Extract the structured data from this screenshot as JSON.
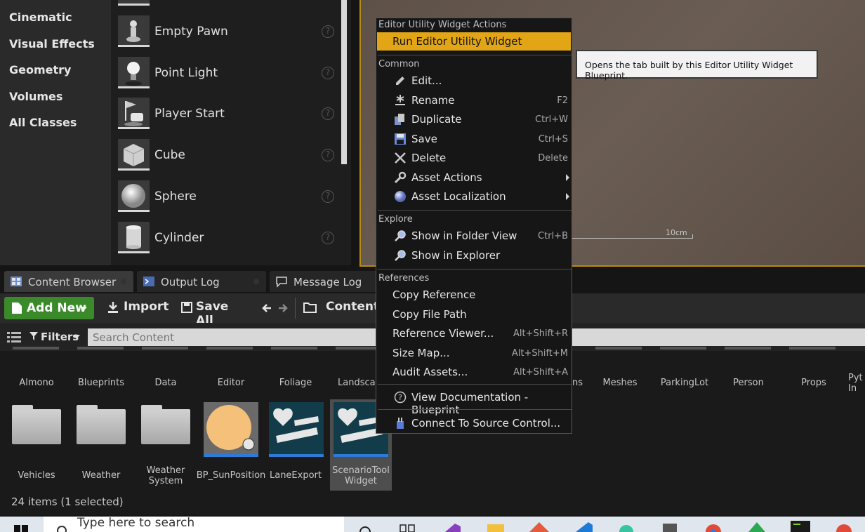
{
  "place_actors": {
    "categories": [
      "Cinematic",
      "Visual Effects",
      "Geometry",
      "Volumes",
      "All Classes"
    ],
    "actors": [
      "Empty Pawn",
      "Point Light",
      "Player Start",
      "Cube",
      "Sphere",
      "Cylinder"
    ]
  },
  "viewport": {
    "scale_label": "10cm"
  },
  "tabs": [
    {
      "label": "Content Browser",
      "icon": "content-browser-icon"
    },
    {
      "label": "Output Log",
      "icon": "output-log-icon"
    },
    {
      "label": "Message Log",
      "icon": "message-log-icon"
    }
  ],
  "toolbar": {
    "add_new": "Add New",
    "import": "Import",
    "save_all": "Save All",
    "path": "Content"
  },
  "search": {
    "filters": "Filters",
    "placeholder": "Search Content"
  },
  "folders_row1": [
    "Almono",
    "Blueprints",
    "Data",
    "Editor",
    "Foliage",
    "Landscap",
    "ns",
    "Meshes",
    "ParkingLot",
    "Person",
    "Props",
    "Pyt\nIn"
  ],
  "row2": [
    {
      "label": "Vehicles",
      "kind": "folder"
    },
    {
      "label": "Weather",
      "kind": "folder"
    },
    {
      "label": "Weather\nSystem",
      "kind": "folder"
    },
    {
      "label": "BP_SunPosition",
      "kind": "blueprint"
    },
    {
      "label": "LaneExport",
      "kind": "widget"
    },
    {
      "label": "ScenarioTool\nWidget",
      "kind": "widget"
    }
  ],
  "status": "24 items (1 selected)",
  "taskbar": {
    "search_placeholder": "Type here to search"
  },
  "context_menu": {
    "header": "Editor Utility Widget Actions",
    "run": "Run Editor Utility Widget",
    "sections": {
      "common": "Common",
      "explore": "Explore",
      "references": "References"
    },
    "common_items": [
      {
        "label": "Edit...",
        "shortcut": "",
        "icon": "pencil-icon"
      },
      {
        "label": "Rename",
        "shortcut": "F2",
        "icon": "rename-icon"
      },
      {
        "label": "Duplicate",
        "shortcut": "Ctrl+W",
        "icon": "duplicate-icon"
      },
      {
        "label": "Save",
        "shortcut": "Ctrl+S",
        "icon": "save-icon"
      },
      {
        "label": "Delete",
        "shortcut": "Delete",
        "icon": "delete-icon"
      },
      {
        "label": "Asset Actions",
        "shortcut": "",
        "icon": "wrench-icon"
      },
      {
        "label": "Asset Localization",
        "shortcut": "",
        "icon": "globe-icon"
      }
    ],
    "explore_items": [
      {
        "label": "Show in Folder View",
        "shortcut": "Ctrl+B"
      },
      {
        "label": "Show in Explorer",
        "shortcut": ""
      }
    ],
    "reference_items": [
      {
        "label": "Copy Reference",
        "shortcut": ""
      },
      {
        "label": "Copy File Path",
        "shortcut": ""
      },
      {
        "label": "Reference Viewer...",
        "shortcut": "Alt+Shift+R"
      },
      {
        "label": "Size Map...",
        "shortcut": "Alt+Shift+M"
      },
      {
        "label": "Audit Assets...",
        "shortcut": "Alt+Shift+A"
      }
    ],
    "documentation": "View Documentation - Blueprint",
    "source_control": "Connect To Source Control..."
  },
  "tooltip": "Opens the tab built by this Editor Utility Widget Blueprint.",
  "colors": {
    "highlight": "#e1a515",
    "add_new_green": "#3a8a2a",
    "selection_blue": "#2d7bd4"
  }
}
